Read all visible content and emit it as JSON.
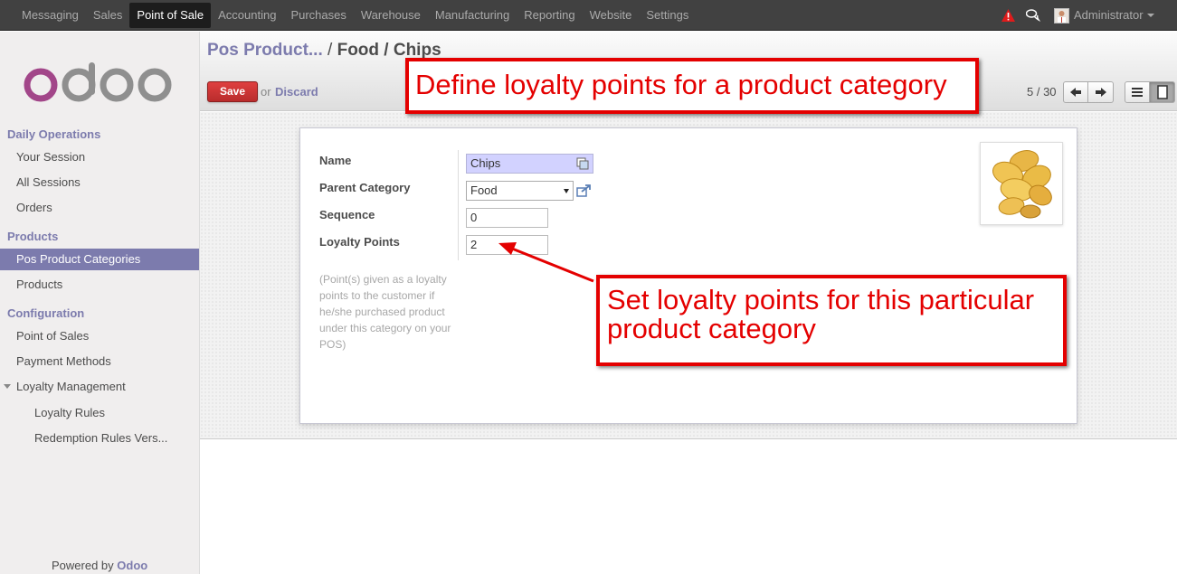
{
  "topbar": {
    "menu": [
      "Messaging",
      "Sales",
      "Point of Sale",
      "Accounting",
      "Purchases",
      "Warehouse",
      "Manufacturing",
      "Reporting",
      "Website",
      "Settings"
    ],
    "active": "Point of Sale",
    "user": "Administrator",
    "icons": [
      "warning-icon",
      "chat-icon"
    ]
  },
  "sidebar": {
    "sections": [
      {
        "title": "Daily Operations",
        "items": [
          "Your Session",
          "All Sessions",
          "Orders"
        ]
      },
      {
        "title": "Products",
        "items": [
          "Pos Product Categories",
          "Products"
        ]
      },
      {
        "title": "Configuration",
        "items": [
          "Point of Sales",
          "Payment Methods"
        ]
      }
    ],
    "loyalty": {
      "label": "Loyalty Management",
      "items": [
        "Loyalty Rules",
        "Redemption Rules Vers..."
      ]
    },
    "active_item": "Pos Product Categories",
    "powered_prefix": "Powered by",
    "powered_brand": "Odoo"
  },
  "control_panel": {
    "breadcrumb": {
      "link": "Pos Product...",
      "sep": " / ",
      "current": "Food / Chips"
    },
    "save_label": "Save",
    "or_text": "or",
    "discard_label": "Discard",
    "pager": "5 / 30"
  },
  "form": {
    "name_label": "Name",
    "name_value": "Chips",
    "parent_label": "Parent Category",
    "parent_value": "Food",
    "sequence_label": "Sequence",
    "sequence_value": "0",
    "loyalty_label": "Loyalty Points",
    "loyalty_value": "2",
    "help_text": "(Point(s) given as a loyalty points to the customer if he/she purchased product under this category on your POS)"
  },
  "annotations": {
    "top": "Define loyalty points for a product category",
    "bottom": "Set loyalty points for this particular product category"
  },
  "colors": {
    "brand": "#7c7bad",
    "save": "#cf3535",
    "annotation": "#e40000",
    "topbar": "#414141"
  }
}
